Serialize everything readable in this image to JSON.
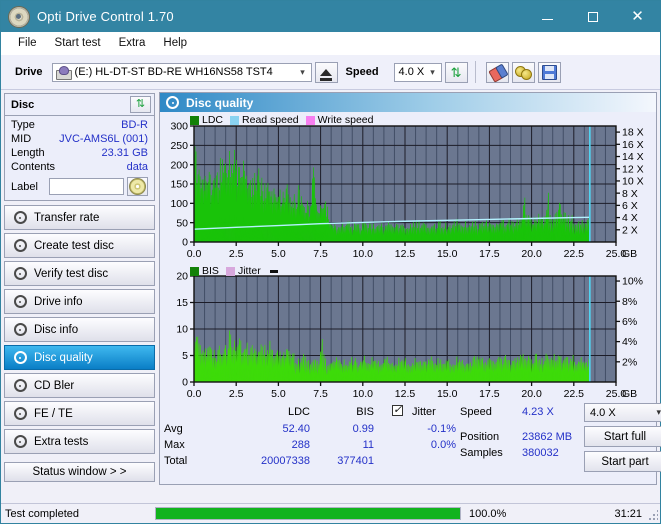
{
  "window": {
    "title": "Opti Drive Control 1.70",
    "icon": "disc-icon",
    "minimize": "–",
    "maximize": "□",
    "close": "✕"
  },
  "menu": {
    "items": [
      "File",
      "Start test",
      "Extra",
      "Help"
    ]
  },
  "toolbar": {
    "drive_label": "Drive",
    "drive_value": "(E:)  HL-DT-ST BD-RE  WH16NS58 TST4",
    "eject_icon": "eject-icon",
    "speed_label": "Speed",
    "speed_value": "4.0 X",
    "refresh_icon": "refresh-icon",
    "erase_icon": "eraser-icon",
    "coins_icon": "coins-icon",
    "save_icon": "save-icon"
  },
  "disc": {
    "header": "Disc",
    "refresh_icon": "refresh-icon",
    "rows": [
      {
        "key": "Type",
        "value": "BD-R"
      },
      {
        "key": "MID",
        "value": "JVC-AMS6L (001)"
      },
      {
        "key": "Length",
        "value": "23.31 GB"
      },
      {
        "key": "Contents",
        "value": "data"
      }
    ],
    "label_key": "Label",
    "label_value": "",
    "label_button_icon": "cd-icon"
  },
  "nav": {
    "items": [
      {
        "label": "Transfer rate",
        "icon": "disc-icon",
        "active": false
      },
      {
        "label": "Create test disc",
        "icon": "disc-icon",
        "active": false
      },
      {
        "label": "Verify test disc",
        "icon": "disc-icon",
        "active": false
      },
      {
        "label": "Drive info",
        "icon": "disc-icon",
        "active": false
      },
      {
        "label": "Disc info",
        "icon": "disc-icon",
        "active": false
      },
      {
        "label": "Disc quality",
        "icon": "disc-icon",
        "active": true
      },
      {
        "label": "CD Bler",
        "icon": "disc-icon",
        "active": false
      },
      {
        "label": "FE / TE",
        "icon": "disc-icon",
        "active": false
      },
      {
        "label": "Extra tests",
        "icon": "disc-icon",
        "active": false
      }
    ],
    "status_window": "Status window > >"
  },
  "panel": {
    "title": "Disc quality",
    "icon": "disc-icon"
  },
  "chart_data": [
    {
      "type": "area",
      "id": "ldc-chart",
      "title": "LDC",
      "legend": [
        {
          "label": "LDC",
          "color": "#138108"
        },
        {
          "label": "Read speed",
          "color": "#8ad2f0"
        },
        {
          "label": "Write speed",
          "color": "#f77ff0"
        }
      ],
      "legend_position": "top-left",
      "xlabel": "GB",
      "x_ticks": [
        "0.0",
        "2.5",
        "5.0",
        "7.5",
        "10.0",
        "12.5",
        "15.0",
        "17.5",
        "20.0",
        "22.5",
        "25.0"
      ],
      "xlim": [
        0,
        25
      ],
      "ylabel_left": "LDC",
      "y_ticks_left": [
        "0",
        "50",
        "100",
        "150",
        "200",
        "250",
        "300"
      ],
      "ylim_left": [
        0,
        300
      ],
      "ylabel_right": "Speed",
      "y_ticks_right": [
        "2 X",
        "4 X",
        "6 X",
        "8 X",
        "10 X",
        "12 X",
        "14 X",
        "16 X",
        "18 X"
      ],
      "ylim_right": [
        0,
        19
      ],
      "grid": true,
      "plot_bg": "#6b7790",
      "series": [
        {
          "name": "LDC",
          "type": "area",
          "color": "#19c309",
          "x": [
            0.0,
            0.12,
            0.24,
            0.36,
            0.48,
            0.6,
            0.72,
            0.84,
            0.96,
            1.08,
            1.2,
            1.32,
            1.44,
            1.56,
            1.68,
            1.8,
            1.92,
            2.04,
            2.16,
            2.28,
            2.4,
            2.52,
            2.64,
            2.76,
            2.88,
            3.0,
            3.12,
            3.24,
            3.36,
            3.48,
            3.6,
            3.72,
            3.84,
            3.96,
            4.08,
            4.2,
            4.32,
            4.44,
            4.56,
            4.68,
            4.8,
            4.92,
            5.04,
            5.16,
            5.28,
            5.4,
            5.52,
            5.64,
            5.76,
            5.88,
            6.0,
            6.12,
            6.24,
            6.36,
            6.48,
            6.6,
            6.72,
            6.84,
            6.96,
            7.08,
            7.2,
            7.32,
            7.44,
            7.56,
            7.68,
            7.8,
            7.92,
            8.04,
            8.16,
            8.28,
            8.4,
            8.64,
            8.88,
            9.12,
            9.36,
            9.6,
            9.84,
            10.08,
            10.32,
            10.56,
            10.8,
            11.04,
            11.28,
            11.52,
            11.76,
            12.0,
            12.5,
            13.0,
            13.5,
            14.0,
            14.5,
            15.0,
            15.5,
            16.0,
            16.5,
            17.0,
            17.5,
            18.0,
            18.5,
            19.0,
            19.3,
            19.6,
            19.9,
            20.2,
            20.5,
            20.8,
            21.0,
            21.2,
            21.4,
            21.6,
            21.7,
            21.85,
            22.0,
            22.2,
            22.4,
            22.6,
            22.8,
            23.0,
            23.2,
            23.4
          ],
          "values": [
            290,
            262,
            215,
            208,
            222,
            196,
            201,
            183,
            189,
            174,
            206,
            213,
            182,
            236,
            241,
            201,
            218,
            251,
            222,
            245,
            262,
            224,
            229,
            208,
            236,
            198,
            188,
            176,
            203,
            171,
            181,
            169,
            192,
            160,
            173,
            157,
            166,
            151,
            160,
            146,
            155,
            142,
            150,
            138,
            147,
            135,
            152,
            141,
            148,
            133,
            140,
            126,
            175,
            120,
            118,
            108,
            115,
            104,
            112,
            232,
            118,
            110,
            106,
            104,
            101,
            113,
            98,
            52,
            50,
            55,
            48,
            52,
            47,
            56,
            49,
            51,
            45,
            54,
            47,
            52,
            44,
            50,
            46,
            55,
            48,
            52,
            46,
            53,
            60,
            49,
            57,
            50,
            62,
            54,
            58,
            51,
            60,
            55,
            64,
            58,
            68,
            120,
            72,
            66,
            80,
            70,
            128,
            75,
            82,
            90,
            126,
            76,
            78,
            70,
            72,
            66,
            68,
            70,
            64,
            62
          ]
        },
        {
          "name": "Read speed",
          "type": "line",
          "color": "#b4f2ff",
          "x": [
            0.0,
            2.5,
            5.0,
            7.5,
            10.0,
            12.5,
            15.0,
            17.5,
            20.0,
            22.5,
            23.4
          ],
          "values_x_speed": [
            2.1,
            2.4,
            2.7,
            3.0,
            3.2,
            3.4,
            3.55,
            3.7,
            3.85,
            4.0,
            4.05
          ]
        }
      ],
      "cursor_x": 23.45,
      "cursor_color": "#4fd8f5"
    },
    {
      "type": "area",
      "id": "bis-chart",
      "title": "BIS",
      "legend": [
        {
          "label": "BIS",
          "color": "#138108"
        },
        {
          "label": "Jitter",
          "color": "#d8a8dd"
        }
      ],
      "legend_position": "top-left",
      "xlabel": "GB",
      "x_ticks": [
        "0.0",
        "2.5",
        "5.0",
        "7.5",
        "10.0",
        "12.5",
        "15.0",
        "17.5",
        "20.0",
        "22.5",
        "25.0"
      ],
      "xlim": [
        0,
        25
      ],
      "ylabel_left": "BIS",
      "y_ticks_left": [
        "0",
        "5",
        "10",
        "15",
        "20"
      ],
      "ylim_left": [
        0,
        20
      ],
      "ylabel_right": "Jitter",
      "y_ticks_right": [
        "2%",
        "4%",
        "6%",
        "8%",
        "10%"
      ],
      "ylim_right": [
        0,
        10.5
      ],
      "grid": true,
      "plot_bg": "#6b7790",
      "series": [
        {
          "name": "BIS",
          "type": "area",
          "color": "#3ddb09",
          "x": [
            0.0,
            0.15,
            0.3,
            0.45,
            0.6,
            0.75,
            0.9,
            1.05,
            1.2,
            1.35,
            1.5,
            1.65,
            1.8,
            1.95,
            2.1,
            2.25,
            2.4,
            2.55,
            2.7,
            2.85,
            3.0,
            3.15,
            3.3,
            3.45,
            3.6,
            3.75,
            3.9,
            4.05,
            4.2,
            4.35,
            4.5,
            4.65,
            4.8,
            4.95,
            5.1,
            5.25,
            5.4,
            5.55,
            5.7,
            5.85,
            6.0,
            6.2,
            6.4,
            6.6,
            6.8,
            7.0,
            7.2,
            7.4,
            7.6,
            7.8,
            8.0,
            8.3,
            8.6,
            8.9,
            9.2,
            9.5,
            9.8,
            10.1,
            10.4,
            10.7,
            11.0,
            11.3,
            11.6,
            11.9,
            12.3,
            12.7,
            13.1,
            13.5,
            13.9,
            14.3,
            14.7,
            15.1,
            15.5,
            15.9,
            16.3,
            16.7,
            17.1,
            17.5,
            17.9,
            18.3,
            18.7,
            19.1,
            19.5,
            19.9,
            20.3,
            20.7,
            21.1,
            21.5,
            21.9,
            22.3,
            22.7,
            23.1,
            23.4
          ],
          "values": [
            6.8,
            10.2,
            8.0,
            7.0,
            8.2,
            6.5,
            7.8,
            6.2,
            7.5,
            6.0,
            8.8,
            7.2,
            6.4,
            8.0,
            11.1,
            7.0,
            8.6,
            6.8,
            9.0,
            7.4,
            6.6,
            8.2,
            7.0,
            8.8,
            6.4,
            7.6,
            6.8,
            9.0,
            7.2,
            6.6,
            8.4,
            7.0,
            6.2,
            7.8,
            6.6,
            7.4,
            6.0,
            6.8,
            5.4,
            6.2,
            4.9,
            5.6,
            4.6,
            6.8,
            4.8,
            5.2,
            4.4,
            5.0,
            9.2,
            4.8,
            5.0,
            4.6,
            5.2,
            4.4,
            5.0,
            4.8,
            4.4,
            5.1,
            4.6,
            4.9,
            4.3,
            5.0,
            4.7,
            4.5,
            4.8,
            4.6,
            5.0,
            4.4,
            4.9,
            4.7,
            5.1,
            4.5,
            4.8,
            5.2,
            4.6,
            5.0,
            4.8,
            5.4,
            4.9,
            5.2,
            5.0,
            5.6,
            5.3,
            5.0,
            5.5,
            5.2,
            5.8,
            5.4,
            5.0,
            5.3,
            4.9,
            4.6,
            4.4
          ]
        }
      ],
      "cursor_x": 23.45,
      "cursor_color": "#4fd8f5"
    }
  ],
  "stats": {
    "col_headers": [
      "LDC",
      "BIS"
    ],
    "rows": [
      {
        "label": "Avg",
        "ldc": "52.40",
        "bis": "0.99",
        "jitter": "-0.1%"
      },
      {
        "label": "Max",
        "ldc": "288",
        "bis": "11",
        "jitter": "0.0%"
      },
      {
        "label": "Total",
        "ldc": "20007338",
        "bis": "377401",
        "jitter": ""
      }
    ],
    "jitter_label": "Jitter",
    "jitter_checked": true,
    "speed_label": "Speed",
    "speed_value": "4.23 X",
    "position_label": "Position",
    "position_value": "23862 MB",
    "samples_label": "Samples",
    "samples_value": "380032",
    "speed_select": "4.0 X",
    "start_full": "Start full",
    "start_part": "Start part"
  },
  "statusbar": {
    "text": "Test completed",
    "progress": 100,
    "percent": "100.0%",
    "time": "31:21"
  },
  "colors": {
    "titlebar": "#3384a3",
    "accent_blue": "#2431c8",
    "plot_bg": "#6b7790",
    "ldc_green": "#19c309",
    "bis_green": "#3ddb09",
    "cursor": "#4fd8f5",
    "progress": "#12b31e"
  }
}
